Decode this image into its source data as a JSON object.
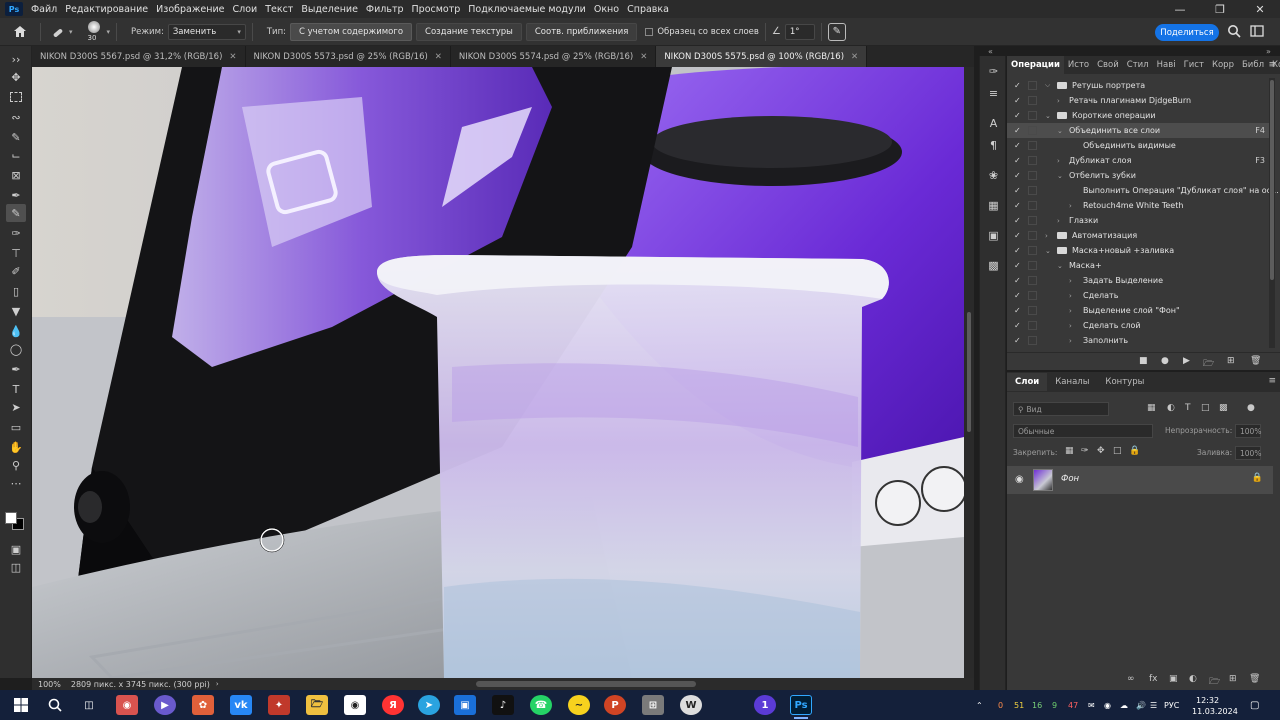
{
  "menubar": {
    "logo": "Ps",
    "items": [
      "Файл",
      "Редактирование",
      "Изображение",
      "Слои",
      "Текст",
      "Выделение",
      "Фильтр",
      "Просмотр",
      "Подключаемые модули",
      "Окно",
      "Справка"
    ]
  },
  "options": {
    "brush_size": "30",
    "mode_label": "Режим:",
    "mode_value": "Заменить",
    "type_label": "Тип:",
    "type_content_aware": "С учетом содержимого",
    "type_texture": "Создание текстуры",
    "type_proximity": "Соотв. приближения",
    "sample_all_layers": "Образец со всех слоев",
    "angle_value": "1°",
    "share_label": "Поделиться"
  },
  "doc_tabs": [
    {
      "label": "NIKON D300S 5567.psd @ 31,2% (RGB/16)"
    },
    {
      "label": "NIKON D300S 5573.psd @ 25% (RGB/16)"
    },
    {
      "label": "NIKON D300S 5574.psd @ 25% (RGB/16)"
    },
    {
      "label": "NIKON D300S 5575.psd @ 100% (RGB/16)"
    }
  ],
  "status": {
    "zoom": "100%",
    "dimensions": "2809 пикс. x 3745 пикс. (300 ppi)"
  },
  "actions_panel": {
    "tabs": [
      "Операции",
      "Исто",
      "Свой",
      "Стил",
      "Наві",
      "Гист",
      "Корр",
      "Библ",
      "Ком"
    ],
    "rows": [
      {
        "label": "Ретушь портрета"
      },
      {
        "label": "Ретачь плагинами DjdgeBurn"
      },
      {
        "label": "Короткие операции"
      },
      {
        "label": "Объединить все слои",
        "key": "F4"
      },
      {
        "label": "Объединить видимые"
      },
      {
        "label": "Дубликат слоя",
        "key": "F3"
      },
      {
        "label": "Отбелить зубки"
      },
      {
        "label": "Выполнить Операция \"Дубликат слоя\" на ос..."
      },
      {
        "label": "Retouch4me White Teeth"
      },
      {
        "label": "Глазки"
      },
      {
        "label": "Автоматизация"
      },
      {
        "label": "Маска+новый +заливка"
      },
      {
        "label": "Маска+"
      },
      {
        "label": "Задать Выделение"
      },
      {
        "label": "Сделать"
      },
      {
        "label": "Выделение слой \"Фон\""
      },
      {
        "label": "Сделать слой"
      },
      {
        "label": "Заполнить"
      }
    ]
  },
  "layers_panel": {
    "tabs": [
      "Слои",
      "Каналы",
      "Контуры"
    ],
    "search_placeholder": "Вид",
    "blend_mode": "Обычные",
    "opacity_label": "Непрозрачность:",
    "opacity_value": "100%",
    "lock_label": "Закрепить:",
    "fill_label": "Заливка:",
    "fill_value": "100%",
    "layers": [
      {
        "name": "Фон"
      }
    ]
  },
  "taskbar": {
    "lang": "РУС",
    "time": "12:32",
    "date": "11.03.2024",
    "tray_numbers": [
      "0",
      "51",
      "16",
      "9",
      "47"
    ]
  },
  "colors": {
    "accent": "#1473e6",
    "iron_purple": "#6f2fd6",
    "panel_bg": "#383838",
    "taskbar_bg": "#14203a"
  }
}
